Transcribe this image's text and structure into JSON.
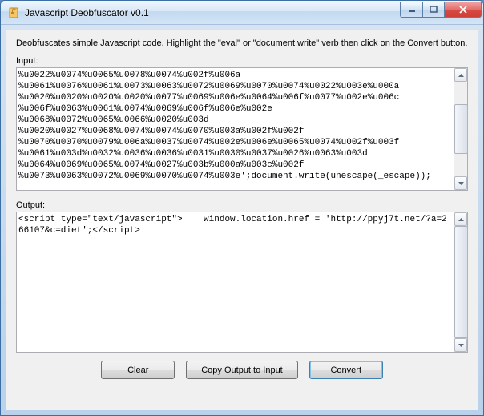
{
  "window": {
    "title": "Javascript Deobfuscator v0.1"
  },
  "instructions": "Deobfuscates simple Javascript code.  Highlight the \"eval\" or \"document.write\" verb then click on the Convert button.",
  "input": {
    "label": "Input:",
    "text": "%u0022%u0074%u0065%u0078%u0074%u002f%u006a\n%u0061%u0076%u0061%u0073%u0063%u0072%u0069%u0070%u0074%u0022%u003e%u000a\n%u0020%u0020%u0020%u0020%u0077%u0069%u006e%u0064%u006f%u0077%u002e%u006c\n%u006f%u0063%u0061%u0074%u0069%u006f%u006e%u002e\n%u0068%u0072%u0065%u0066%u0020%u003d\n%u0020%u0027%u0068%u0074%u0074%u0070%u003a%u002f%u002f\n%u0070%u0070%u0079%u006a%u0037%u0074%u002e%u006e%u0065%u0074%u002f%u003f\n%u0061%u003d%u0032%u0036%u0036%u0031%u0030%u0037%u0026%u0063%u003d\n%u0064%u0069%u0065%u0074%u0027%u003b%u000a%u003c%u002f\n%u0073%u0063%u0072%u0069%u0070%u0074%u003e';document.write(unescape(_escape));"
  },
  "output": {
    "label": "Output:",
    "text": "<script type=\"text/javascript\">    window.location.href = 'http://ppyj7t.net/?a=266107&c=diet';</script>"
  },
  "buttons": {
    "clear": "Clear",
    "copy": "Copy Output to Input",
    "convert": "Convert"
  }
}
